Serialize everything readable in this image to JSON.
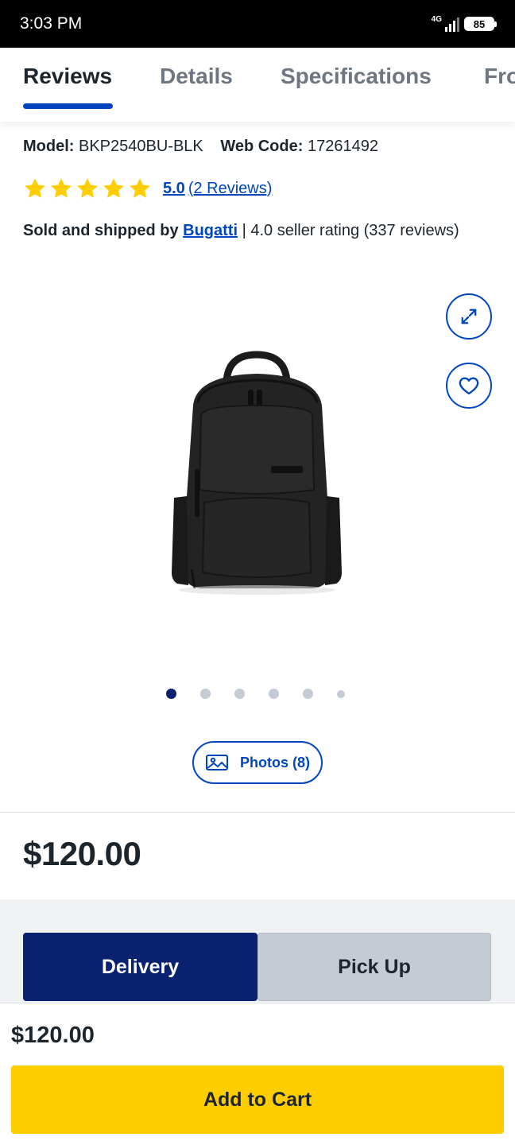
{
  "status_bar": {
    "time": "3:03 PM",
    "network": "4G",
    "battery": "85"
  },
  "tabs": [
    {
      "label": "Reviews",
      "active": true
    },
    {
      "label": "Details",
      "active": false
    },
    {
      "label": "Specifications",
      "active": false
    },
    {
      "label": "Fro",
      "active": false
    }
  ],
  "product": {
    "model_label": "Model:",
    "model_value": "BKP2540BU-BLK",
    "web_code_label": "Web Code:",
    "web_code_value": "17261492",
    "rating_score": "5.0",
    "rating_count": "(2 Reviews)",
    "stars": 5,
    "sold_by_label": "Sold and shipped by",
    "seller": "Bugatti",
    "seller_rating": "| 4.0 seller rating (337 reviews)",
    "image_icon": "backpack-image"
  },
  "gallery": {
    "expand_icon": "expand-icon",
    "wishlist_icon": "heart-icon",
    "dot_count": 6,
    "active_dot": 0,
    "photos_label": "Photos (8)"
  },
  "price": "$120.00",
  "fulfillment": {
    "delivery_label": "Delivery",
    "pickup_label": "Pick Up",
    "selected": "Delivery"
  },
  "footer": {
    "price": "$120.00",
    "add_to_cart_label": "Add to Cart"
  },
  "colors": {
    "accent_blue": "#0046be",
    "navy": "#0a2270",
    "star_yellow": "#ffce00",
    "cart_yellow": "#ffce00"
  }
}
